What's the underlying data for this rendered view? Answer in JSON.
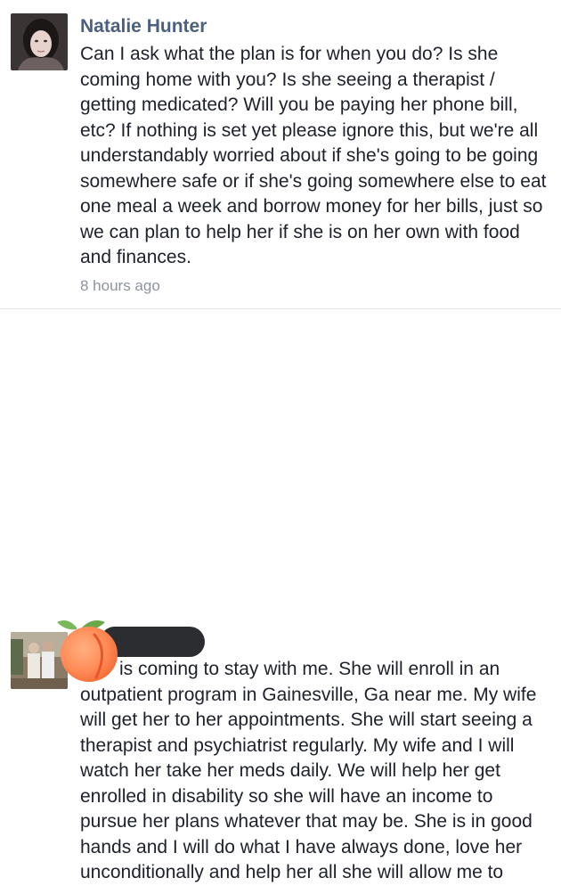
{
  "comments": [
    {
      "author": "Natalie Hunter",
      "text": "Can I ask what the plan is for when you do? Is she coming home with you? Is she seeing a therapist / getting medicated? Will you be paying her phone bill, etc? If nothing is set yet please ignore this, but we're all understandably worried about if she's going to be going somewhere safe or if she's going somewhere else to eat one meal a week and borrow money for her bills, just so we can plan to help her if she is on her own with food and finances.",
      "timestamp": "8 hours ago",
      "avatar_icon": "profile-photo"
    },
    {
      "author": "",
      "text": "is coming to stay with me. She will enroll in an outpatient program in Gainesville, Ga near me. My wife will get her to her appointments. She will start seeing a therapist and psychiatrist regularly. My wife and I will watch her take her meds daily. We will help her get enrolled in disability so she will have an income to pursue her plans whatever that may be. She is in good hands and I will do what I have always done, love her unconditionally and help her all she will allow me to",
      "avatar_icon": "profile-photo",
      "redaction_icon": "peach-emoji-icon"
    }
  ],
  "colors": {
    "author_name": "#4b5f7f",
    "body_text": "#1d2129",
    "timestamp": "#8d949e",
    "divider": "#e6e7e9",
    "peach": "#ff8c5a"
  }
}
